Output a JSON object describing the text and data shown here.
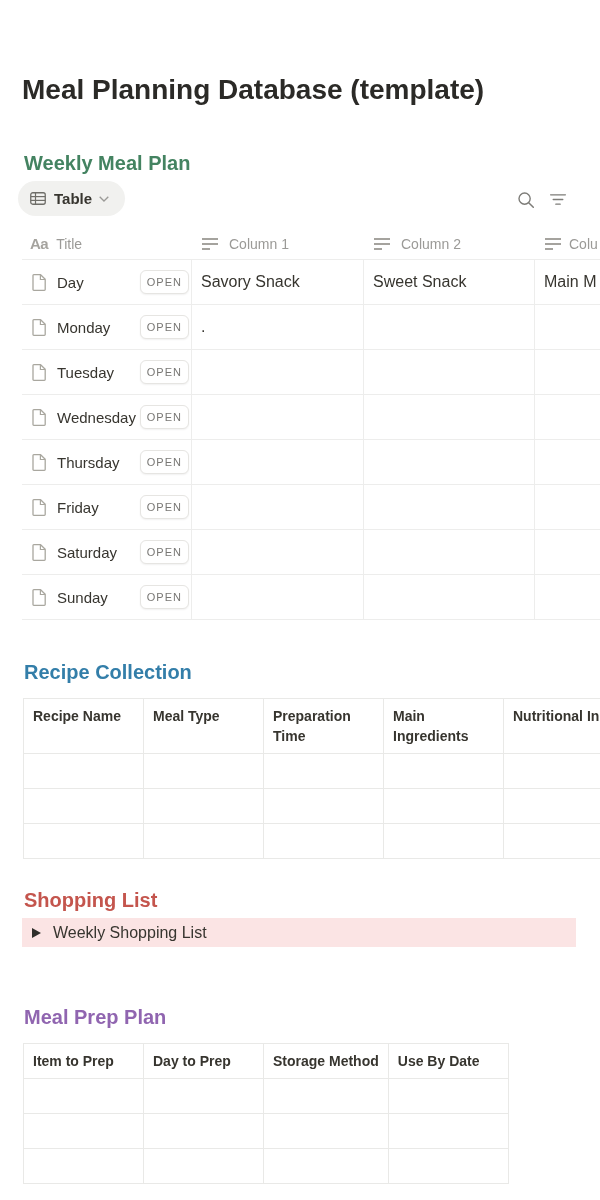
{
  "page": {
    "title": "Meal Planning Database (template)"
  },
  "sections": [
    {
      "kind": "database",
      "heading": "Weekly Meal Plan",
      "color": "#448361",
      "view": {
        "label": "Table"
      },
      "columns": [
        {
          "kind": "title",
          "glyph": "Aa",
          "label": "Title"
        },
        {
          "kind": "text",
          "label": "Column 1"
        },
        {
          "kind": "text",
          "label": "Column 2"
        },
        {
          "kind": "text",
          "label": "Colu"
        }
      ],
      "rows": [
        {
          "title": "Day",
          "open": "OPEN",
          "cells": [
            "Savory Snack",
            "Sweet Snack",
            "Main M"
          ]
        },
        {
          "title": "Monday",
          "open": "OPEN",
          "cells": [
            "."
          ]
        },
        {
          "title": "Tuesday",
          "open": "OPEN"
        },
        {
          "title": "Wednesday",
          "open": "OPEN"
        },
        {
          "title": "Thursday",
          "open": "OPEN"
        },
        {
          "title": "Friday",
          "open": "OPEN"
        },
        {
          "title": "Saturday",
          "open": "OPEN"
        },
        {
          "title": "Sunday",
          "open": "OPEN"
        }
      ]
    },
    {
      "kind": "table",
      "heading": "Recipe Collection",
      "color": "#337ea9",
      "columns": [
        "Recipe Name",
        "Meal Type",
        "Preparation Time",
        "Main Ingredients",
        "Nutritional In"
      ],
      "rows": [
        {},
        {},
        {}
      ]
    },
    {
      "kind": "toggle",
      "heading": "Shopping List",
      "color": "#c4554d",
      "toggle": {
        "label": "Weekly Shopping List",
        "expanded": false
      }
    },
    {
      "kind": "table",
      "heading": "Meal Prep Plan",
      "color": "#9065b0",
      "columns": [
        "Item to Prep",
        "Day to Prep",
        "Storage Method",
        "Use By Date"
      ],
      "rows": [
        {},
        {},
        {}
      ]
    }
  ]
}
